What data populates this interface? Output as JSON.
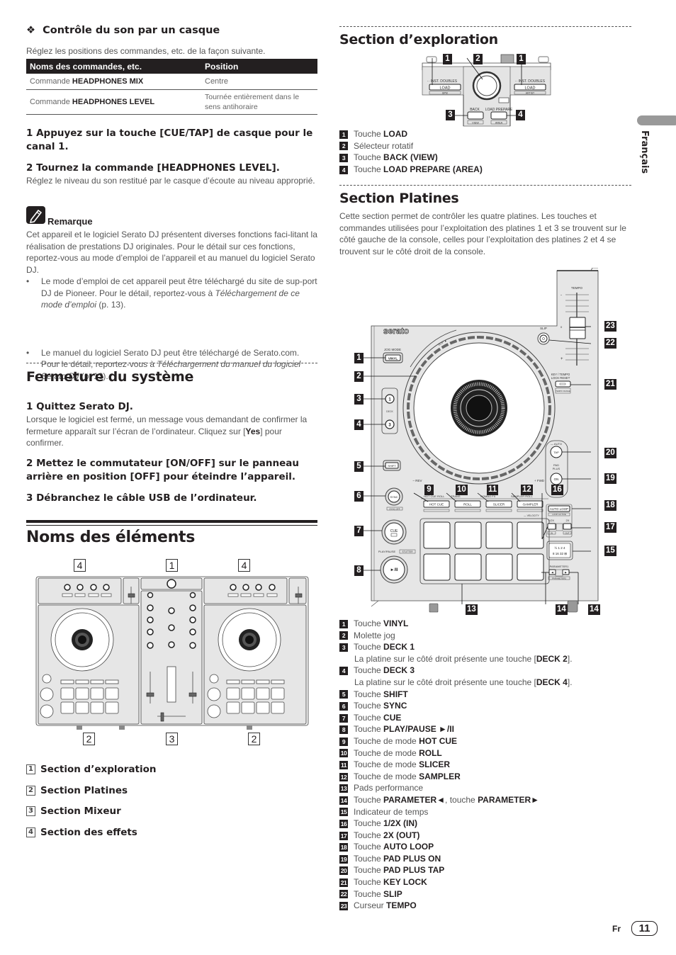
{
  "side_tab": {
    "language": "Français"
  },
  "footer": {
    "lang_code": "Fr",
    "page_number": "11"
  },
  "left": {
    "headphones": {
      "title_icon": "❖",
      "title": "Contrôle du son par un casque",
      "intro": "Réglez les positions des commandes, etc. de la façon suivante.",
      "table": {
        "headers": [
          "Noms des commandes, etc.",
          "Position"
        ],
        "rows": [
          {
            "prefix": "Commande ",
            "name": "HEADPHONES MIX",
            "position": "Centre"
          },
          {
            "prefix": "Commande ",
            "name": "HEADPHONES LEVEL",
            "position": "Tournée entièrement dans le sens antihoraire"
          }
        ]
      },
      "step1": "1   Appuyez sur la touche [CUE/TAP] de casque pour le canal 1.",
      "step2": "2   Tournez la commande [HEADPHONES LEVEL].",
      "step2_body": "Réglez le niveau du son restitué par le casque d’écoute au niveau approprié."
    },
    "note": {
      "icon": "pencil-note-icon",
      "title": "Remarque",
      "body": "Cet appareil et le logiciel Serato DJ présentent diverses fonctions faci-litant la réalisation de prestations DJ originales. Pour le détail sur ces fonctions, reportez-vous au mode d’emploi de l’appareil et au manuel du logiciel Serato DJ.",
      "bullets": [
        {
          "text": "Le mode d’emploi de cet appareil peut être téléchargé du site de sup-port DJ de Pioneer. Pour le détail, reportez-vous à ",
          "italic": "Téléchargement de ce mode d’emploi",
          "tail": " (p. 13)."
        },
        {
          "text": "Le manuel du logiciel Serato DJ peut être téléchargé de Serato.com. Pour le détail, reportez-vous à ",
          "italic": "Téléchargement du manuel du logiciel Serato DJ",
          "tail": " (p. 13)."
        }
      ]
    },
    "shutdown": {
      "title": "Fermeture du système",
      "step1": "1   Quittez Serato DJ.",
      "step1_body_a": "Lorsque le logiciel est fermé, un message vous demandant de confirmer la fermeture apparaît sur l’écran de l’ordinateur. Cliquez sur [",
      "step1_body_bold": "Yes",
      "step1_body_b": "] pour confirmer.",
      "step2": "2   Mettez le commutateur [ON/OFF] sur le panneau arrière en position [OFF] pour éteindre l’appareil.",
      "step3": "3   Débranchez le câble USB de l’ordinateur."
    },
    "elements": {
      "title": "Noms des éléments",
      "diagram_labels_top": [
        "4",
        "1",
        "4"
      ],
      "diagram_labels_bottom": [
        "2",
        "3",
        "2"
      ],
      "list": [
        {
          "num": "1",
          "label": "Section d’exploration"
        },
        {
          "num": "2",
          "label": "Section Platines"
        },
        {
          "num": "3",
          "label": "Section Mixeur"
        },
        {
          "num": "4",
          "label": "Section des effets"
        }
      ]
    }
  },
  "right": {
    "browse": {
      "title": "Section d’exploration",
      "diagram": {
        "callouts": [
          "1",
          "2",
          "1",
          "3",
          "4"
        ],
        "labels": {
          "inst_doubles": "INST. DOUBLES",
          "load": "LOAD",
          "bpm": "BPM",
          "artist": "ARTIST",
          "back": "BACK",
          "load_prepare": "LOAD PREPARE",
          "view": "VIEW",
          "area": "AREA"
        }
      },
      "legend": [
        {
          "num": "1",
          "prefix": "Touche ",
          "bold": "LOAD"
        },
        {
          "num": "2",
          "prefix": "Sélecteur rotatif",
          "bold": ""
        },
        {
          "num": "3",
          "prefix": "Touche ",
          "bold": "BACK (VIEW)"
        },
        {
          "num": "4",
          "prefix": "Touche ",
          "bold": "LOAD PREPARE (AREA)"
        }
      ]
    },
    "decks": {
      "title": "Section Platines",
      "intro": "Cette section permet de contrôler les quatre platines. Les touches et commandes utilisées pour l’exploitation des platines 1 et 3 se trouvent sur le côté gauche de la console, celles pour l’exploitation des platines 2 et 4 se trouvent sur le côté droit de la console.",
      "diagram": {
        "labels": {
          "serato": "serato",
          "jog_mode": "JOG MODE",
          "vinyl": "VINYL",
          "deck": "DECK",
          "deck1": "1",
          "deck3": "3",
          "shift": "SHIFT",
          "sync": "SYNC",
          "sync_off": "SYNC OFF",
          "cue": "CUE",
          "play_pause": "PLAY/PAUSE",
          "stutter": "STUTTER",
          "play_glyph": "►/II",
          "tempo": "TEMPO",
          "slip": "SLIP",
          "key_lock": "KEY LOCK",
          "tempo_reset": "TEMPO RESET",
          "tempo_range": "TEMPO RANGE",
          "auto": "AUTO",
          "tap": "TAP",
          "pad_plus": "PAD PLUS",
          "on": "ON",
          "rev": "REV",
          "fwd": "FWD",
          "hot_cue_roll": "HOT CUE ROLL",
          "trans": "TRANS",
          "combo_fx": "COMBO FX",
          "sampler_roll": "SAMPLER ROLL",
          "hot_cue": "HOT CUE",
          "roll": "ROLL",
          "slicer": "SLICER",
          "sampler": "SAMPLER",
          "velocity": "VELOCITY",
          "auto_loop": "AUTO LOOP",
          "loop_active": "LOOP ACTIVE",
          "half_x": "1/2X",
          "two_x": "2X",
          "in": "IN",
          "out": "OUT",
          "beats": [
            "1/2",
            "1",
            "2",
            "4",
            "8",
            "16",
            "32",
            "+"
          ],
          "parameter1": "PARAMETER1",
          "parameter2": "PARAMETER2"
        },
        "callouts_left": [
          "1",
          "2",
          "3",
          "4",
          "5",
          "6",
          "7",
          "8"
        ],
        "callouts_mode": [
          "9",
          "10",
          "11",
          "12",
          "16"
        ],
        "callouts_right": [
          "23",
          "22",
          "21",
          "20",
          "19",
          "18",
          "17",
          "15"
        ],
        "callouts_bottom": [
          "13",
          "14",
          "14"
        ]
      },
      "legend": [
        {
          "num": "1",
          "prefix": "Touche ",
          "bold": "VINYL"
        },
        {
          "num": "2",
          "prefix": "Molette jog",
          "bold": ""
        },
        {
          "num": "3",
          "prefix": "Touche ",
          "bold": "DECK 1",
          "sub_a": "La platine sur le côté droit présente une touche [",
          "sub_b": "DECK 2",
          "sub_c": "]."
        },
        {
          "num": "4",
          "prefix": "Touche ",
          "bold": "DECK 3",
          "sub_a": "La platine sur le côté droit présente une touche [",
          "sub_b": "DECK 4",
          "sub_c": "]."
        },
        {
          "num": "5",
          "prefix": "Touche ",
          "bold": "SHIFT"
        },
        {
          "num": "6",
          "prefix": "Touche ",
          "bold": "SYNC"
        },
        {
          "num": "7",
          "prefix": "Touche ",
          "bold": "CUE"
        },
        {
          "num": "8",
          "prefix": "Touche ",
          "bold": "PLAY/PAUSE ►/II"
        },
        {
          "num": "9",
          "prefix": "Touche de mode ",
          "bold": "HOT CUE"
        },
        {
          "num": "10",
          "prefix": "Touche de mode ",
          "bold": "ROLL"
        },
        {
          "num": "11",
          "prefix": "Touche de mode ",
          "bold": "SLICER"
        },
        {
          "num": "12",
          "prefix": "Touche de mode ",
          "bold": "SAMPLER"
        },
        {
          "num": "13",
          "prefix": "Pads performance",
          "bold": ""
        },
        {
          "num": "14",
          "prefix": "Touche ",
          "bold": "PARAMETER◄",
          "mid": ", touche ",
          "bold2": "PARAMETER►"
        },
        {
          "num": "15",
          "prefix": "Indicateur de temps",
          "bold": ""
        },
        {
          "num": "16",
          "prefix": "Touche ",
          "bold": "1/2X (IN)"
        },
        {
          "num": "17",
          "prefix": "Touche ",
          "bold": "2X (OUT)"
        },
        {
          "num": "18",
          "prefix": "Touche ",
          "bold": "AUTO LOOP"
        },
        {
          "num": "19",
          "prefix": "Touche ",
          "bold": "PAD PLUS ON"
        },
        {
          "num": "20",
          "prefix": "Touche ",
          "bold": "PAD PLUS TAP"
        },
        {
          "num": "21",
          "prefix": "Touche ",
          "bold": "KEY LOCK"
        },
        {
          "num": "22",
          "prefix": "Touche ",
          "bold": "SLIP"
        },
        {
          "num": "23",
          "prefix": "Curseur ",
          "bold": "TEMPO"
        }
      ]
    }
  }
}
